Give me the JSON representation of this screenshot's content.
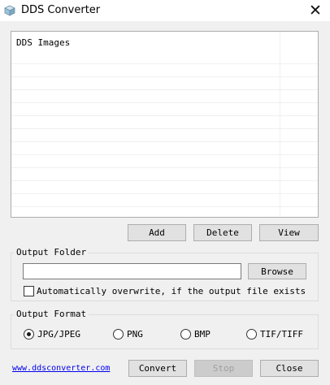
{
  "window": {
    "title": "DDS Converter",
    "close_glyph": "✕"
  },
  "list": {
    "header": "DDS Images"
  },
  "list_buttons": {
    "add": "Add",
    "delete": "Delete",
    "view": "View"
  },
  "output_folder": {
    "label": "Output Folder",
    "path_value": "",
    "browse": "Browse",
    "overwrite_checked": false,
    "overwrite_label": "Automatically overwrite, if the output file exists"
  },
  "output_format": {
    "label": "Output Format",
    "selected": "JPG/JPEG",
    "options": [
      "JPG/JPEG",
      "PNG",
      "BMP",
      "TIF/TIFF"
    ]
  },
  "footer": {
    "link": "www.ddsconverter.com",
    "convert": "Convert",
    "stop": "Stop",
    "close": "Close"
  },
  "colors": {
    "link": "#0000ee",
    "window_bg": "#f0f0f0"
  }
}
